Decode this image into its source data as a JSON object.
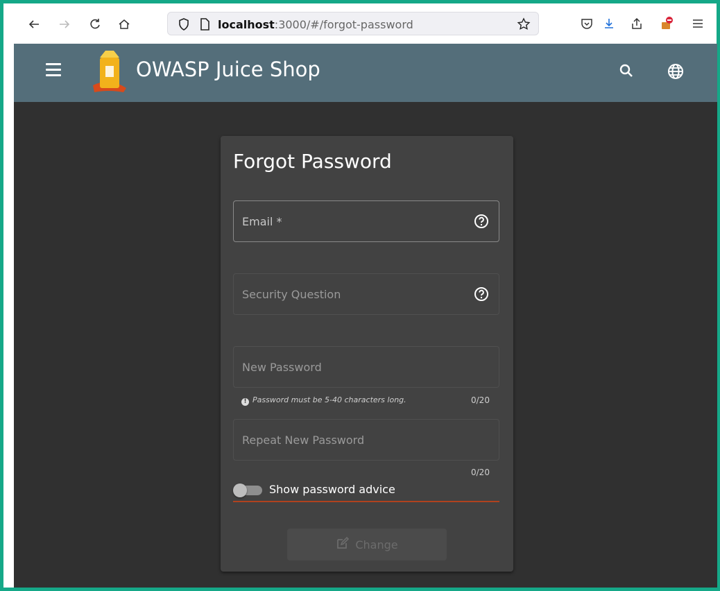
{
  "browser": {
    "url_host": "localhost",
    "url_path": ":3000/#/forgot-password"
  },
  "app": {
    "title": "OWASP Juice Shop"
  },
  "form": {
    "title": "Forgot Password",
    "email_label": "Email *",
    "security_question_label": "Security Question",
    "new_password_label": "New Password",
    "new_password_hint": "Password must be 5-40 characters long.",
    "new_password_counter": "0/20",
    "repeat_password_label": "Repeat New Password",
    "repeat_password_counter": "0/20",
    "show_advice_label": "Show password advice",
    "submit_label": "Change"
  },
  "colors": {
    "header": "#546e7a",
    "background": "#303030",
    "card": "#424242",
    "accent_underline": "#b0421e",
    "frame": "#15a888"
  }
}
